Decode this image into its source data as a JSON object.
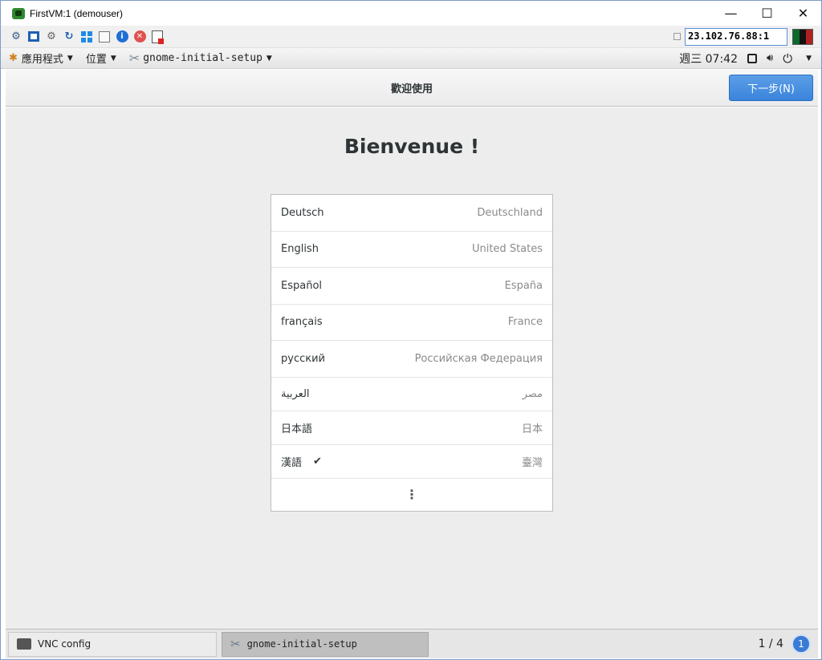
{
  "window": {
    "title": "FirstVM:1 (demouser)",
    "minimize": "—",
    "maximize": "☐",
    "close": "✕"
  },
  "vnc_toolbar": {
    "host": "23.102.76.88:1"
  },
  "gnome_bar": {
    "applications": "應用程式",
    "places": "位置",
    "active_app": "gnome-initial-setup",
    "clock": "週三 07:42"
  },
  "header": {
    "title": "歡迎使用",
    "next_button": "下一步(N)"
  },
  "main": {
    "welcome": "Bienvenue !",
    "languages": [
      {
        "name": "Deutsch",
        "region": "Deutschland",
        "selected": false
      },
      {
        "name": "English",
        "region": "United States",
        "selected": false
      },
      {
        "name": "Español",
        "region": "España",
        "selected": false
      },
      {
        "name": "français",
        "region": "France",
        "selected": false
      },
      {
        "name": "русский",
        "region": "Российская Федерация",
        "selected": false
      },
      {
        "name": "العربية",
        "region": "مصر",
        "selected": false
      },
      {
        "name": "日本語",
        "region": "日本",
        "selected": false
      },
      {
        "name": "漢語",
        "region": "臺灣",
        "selected": true
      }
    ],
    "more": "⋮"
  },
  "taskbar": {
    "items": [
      {
        "label": "VNC config"
      },
      {
        "label": "gnome-initial-setup"
      }
    ],
    "pager": "1 / 4",
    "pager_badge": "1"
  },
  "colors": {
    "accent": "#3a84dc",
    "background": "#ededed"
  }
}
